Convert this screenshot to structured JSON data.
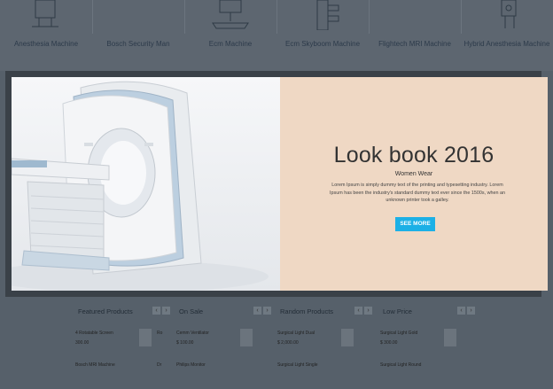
{
  "top_products": [
    {
      "name": "Anesthesia Machine",
      "icon": "anesthesia-machine-icon"
    },
    {
      "name": "Bosch Security Man",
      "icon": "security-device-icon"
    },
    {
      "name": "Ecm Machine",
      "icon": "ecm-machine-icon"
    },
    {
      "name": "Ecm Skyboom Machine",
      "icon": "skyboom-machine-icon"
    },
    {
      "name": "Flightech MRI Machine",
      "icon": "mri-machine-icon"
    },
    {
      "name": "Hybrid Anesthesia Machine",
      "icon": "hybrid-anesthesia-icon"
    }
  ],
  "banner": {
    "title": "Look book 2016",
    "subtitle": "Women Wear",
    "description": "Lorem Ipsum is simply dummy text of the printing and typesetting industry. Lorem Ipsum has been the industry's standard dummy text ever since the 1500s, when an unknown printer took a galley.",
    "button_label": "SEE MORE",
    "image_icon": "mri-scanner-image",
    "bg_color": "#efd8c4",
    "button_color": "#1cb0e6"
  },
  "columns": [
    {
      "title": "Featured Products",
      "items": [
        {
          "name": "4 Rotatable Screen",
          "price": "300.00",
          "extra": "Ro"
        },
        {
          "name": "Bosch MRI Machine",
          "price": "",
          "extra": "Dr"
        }
      ]
    },
    {
      "title": "On Sale",
      "items": [
        {
          "name": "Cemm Ventilator",
          "price": "$ 100.00",
          "extra": ""
        },
        {
          "name": "Philips Monitor",
          "price": "",
          "extra": ""
        }
      ]
    },
    {
      "title": "Random Products",
      "items": [
        {
          "name": "Surgical Light Dual",
          "price": "$ 2,000.00",
          "extra": ""
        },
        {
          "name": "Surgical Light Single",
          "price": "",
          "extra": ""
        }
      ]
    },
    {
      "title": "Low Price",
      "items": [
        {
          "name": "Surgical Light Gold",
          "price": "$ 300.00",
          "extra": ""
        },
        {
          "name": "Surgical Light Round",
          "price": "",
          "extra": ""
        }
      ]
    }
  ],
  "nav": {
    "prev": "‹",
    "next": "›"
  }
}
